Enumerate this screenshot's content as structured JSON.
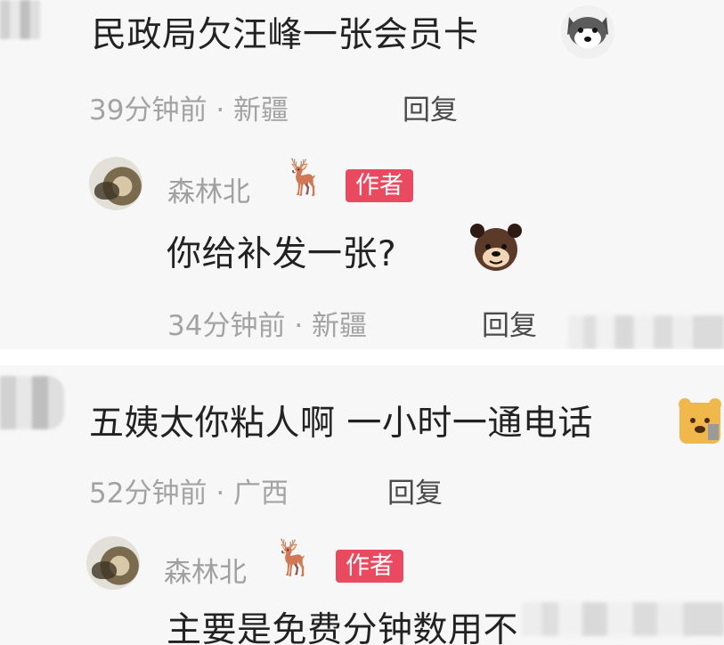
{
  "comments": [
    {
      "text": "民政局欠汪峰一张会员卡",
      "time": "39分钟前",
      "dot": "·",
      "location": "新疆",
      "reply_label": "回复",
      "author_reply": {
        "username": "森林北",
        "badge": "作者",
        "text": "你给补发一张?",
        "time": "34分钟前",
        "dot": "·",
        "location": "新疆",
        "reply_label": "回复"
      }
    },
    {
      "text": "五姨太你粘人啊 一小时一通电话",
      "time": "52分钟前",
      "dot": "·",
      "location": "广西",
      "reply_label": "回复",
      "author_reply": {
        "username": "森林北",
        "badge": "作者",
        "text": "主要是免费分钟数用不"
      }
    }
  ],
  "emoji": {
    "deer": "🦌",
    "dog_face": "🐶",
    "bear_face": "🐻"
  },
  "colors": {
    "panel_bg": "#f7f7f7",
    "badge_bg": "#ea4a5f",
    "meta_text": "#a3a3a3",
    "body_text": "#222222"
  }
}
